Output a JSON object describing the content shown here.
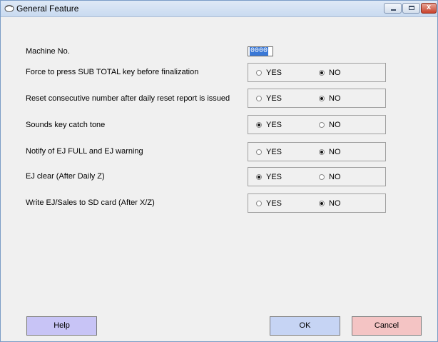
{
  "window": {
    "title": "General Feature",
    "controls": [
      "minimize-icon",
      "maximize-icon",
      "close-icon"
    ],
    "close_glyph": "x"
  },
  "machine_no": {
    "label": "Machine No.",
    "value": "0000"
  },
  "options_labels": {
    "yes": "YES",
    "no": "NO"
  },
  "settings": [
    {
      "label": "Force to press SUB TOTAL key before finalization",
      "selected": "NO"
    },
    {
      "label": "Reset consecutive number after daily reset report is issued",
      "selected": "NO"
    },
    {
      "label": "Sounds key catch tone",
      "selected": "YES"
    },
    {
      "label": "Notify of EJ FULL and EJ warning",
      "selected": "NO"
    },
    {
      "label": "EJ clear (After Daily Z)",
      "selected": "YES"
    },
    {
      "label": "Write EJ/Sales to SD card (After X/Z)",
      "selected": "NO"
    }
  ],
  "buttons": {
    "help": "Help",
    "ok": "OK",
    "cancel": "Cancel"
  },
  "colors": {
    "help": "#c8c4f6",
    "ok": "#c6d4f4",
    "cancel": "#f4c4c4",
    "selection": "#3a78d6"
  }
}
